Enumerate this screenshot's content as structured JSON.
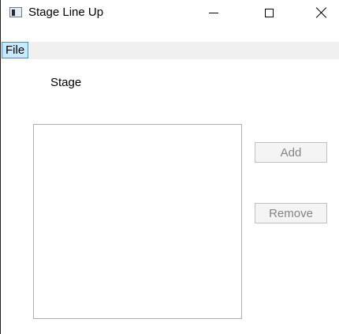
{
  "window": {
    "title": "Stage Line Up",
    "icon": "app-window-icon",
    "controls": {
      "minimize": "minimize-icon",
      "maximize": "maximize-icon",
      "close": "close-icon"
    }
  },
  "menu": {
    "items": [
      {
        "label": "File"
      }
    ]
  },
  "content": {
    "stage_label": "Stage",
    "buttons": {
      "add": "Add",
      "remove": "Remove"
    }
  }
}
